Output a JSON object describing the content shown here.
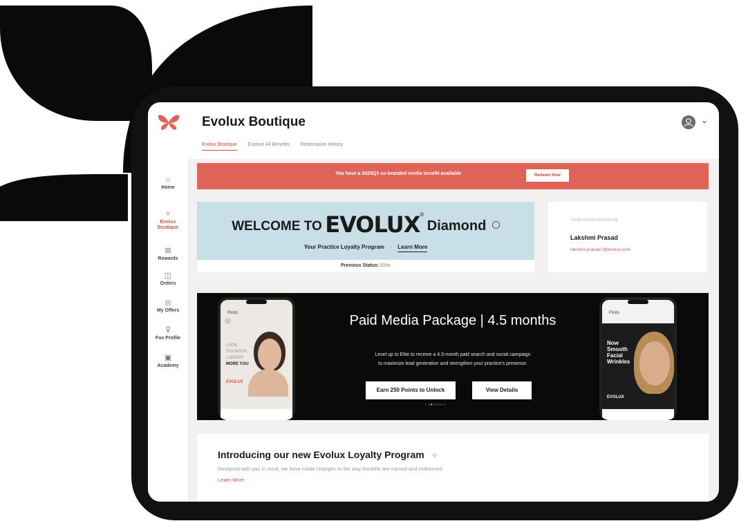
{
  "colors": {
    "accent": "#e06358",
    "brand_red": "#d9544a",
    "frame": "#111111",
    "welcome_bg": "#c9dfe7",
    "promo_bg": "#0a0a0a"
  },
  "header": {
    "title": "Evolux Boutique",
    "tabs": [
      {
        "label": "Evolux Boutique",
        "active": true
      },
      {
        "label": "Explore All Benefits",
        "active": false
      },
      {
        "label": "Redemption History",
        "active": false
      }
    ],
    "avatar_icon": "user-avatar-icon",
    "menu_icon": "chevron-down-icon"
  },
  "sidebar": {
    "logo_icon": "butterfly-logo-icon",
    "items": [
      {
        "label": "Home",
        "icon": "home-icon",
        "active": false
      },
      {
        "label": "Evolux Boutique",
        "icon": "sparkle-icon",
        "active": true
      },
      {
        "label": "Rewards",
        "icon": "gift-icon",
        "active": false
      },
      {
        "label": "Orders",
        "icon": "bag-icon",
        "active": false
      },
      {
        "label": "My Offers",
        "icon": "tag-icon",
        "active": false
      },
      {
        "label": "Fox Profile",
        "icon": "location-icon",
        "active": false
      },
      {
        "label": "Academy",
        "icon": "book-icon",
        "active": false
      }
    ]
  },
  "banner": {
    "text": "You have a 2025Q3 co-branded media benefit available",
    "button": "Redeem Now"
  },
  "welcome": {
    "prefix": "WELCOME TO",
    "brand": "EVOLUX",
    "registered": "®",
    "tier": "Diamond",
    "subtitle": "Your Practice Loyalty Program",
    "separator": "·",
    "learn_more": "Learn More",
    "previous_status_label": "Previous Status:",
    "previous_status_value": "Elite"
  },
  "rep": {
    "label": "YOUR REPRESENTATIVE",
    "name": "Lakshmi Prasad",
    "email": "lakshmi.prasad.r@evolux.com"
  },
  "promo": {
    "title": "Paid Media Package | 4.5 months",
    "description_line1": "Level up to Elite to receive a 4.5-month paid search and social campaign",
    "description_line2": "to maximize lead generation and strengthen your practice's presence.",
    "primary_button": "Earn 250 Points to Unlock",
    "secondary_button": "View Details",
    "carousel": "‹ ○●○○○○ ›",
    "left_phone": {
      "header": "Posts",
      "lines": [
        "LOOK",
        "YOUNGER",
        "LONGER",
        "MORE YOU"
      ],
      "brand": "EVOLUX"
    },
    "right_phone": {
      "header": "Posts",
      "lines": [
        "Now",
        "Smooth",
        "Facial",
        "Wrinkles"
      ],
      "brand": "EVOLUX"
    }
  },
  "intro": {
    "title": "Introducing our new Evolux Loyalty Program",
    "icon": "sparkle-icon",
    "description": "Designed with you in mind, we have made changes to the way benefits are earned and redeemed.",
    "link": "Learn More"
  }
}
